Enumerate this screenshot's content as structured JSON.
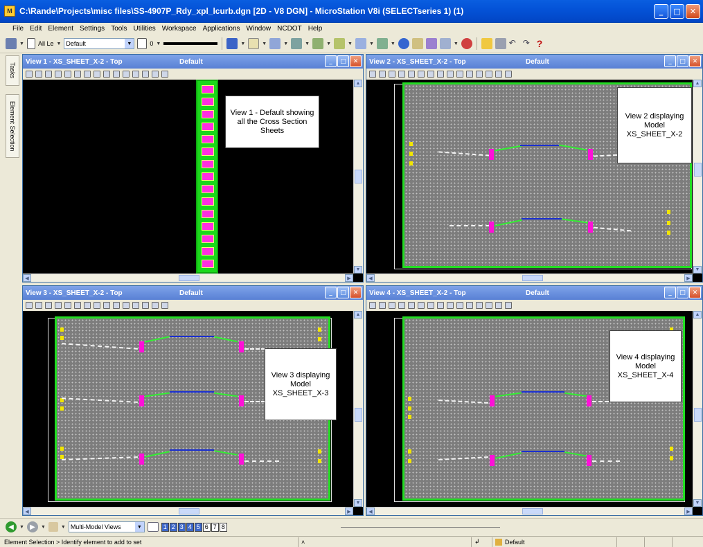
{
  "window": {
    "title": "C:\\Rande\\Projects\\misc files\\SS-4907P_Rdy_xpl_lcurb.dgn [2D - V8 DGN] - MicroStation V8i (SELECTseries 1) (1)"
  },
  "menu": [
    "File",
    "Edit",
    "Element",
    "Settings",
    "Tools",
    "Utilities",
    "Workspace",
    "Applications",
    "Window",
    "NCDOT",
    "Help"
  ],
  "toolbar": {
    "level_label": "All Le",
    "style_value": "Default",
    "weight_value": "0"
  },
  "side_tabs": [
    "Tasks",
    "Element Selection"
  ],
  "views": [
    {
      "title": "View 1 - XS_SHEET_X-2 - Top",
      "model": "Default",
      "callout": "View 1 - Default showing all the Cross Section Sheets"
    },
    {
      "title": "View 2 - XS_SHEET_X-2 - Top",
      "model": "Default",
      "callout": "View 2 displaying Model XS_SHEET_X-2"
    },
    {
      "title": "View 3 - XS_SHEET_X-2 - Top",
      "model": "Default",
      "callout": "View 3 displaying Model XS_SHEET_X-3"
    },
    {
      "title": "View 4 - XS_SHEET_X-2 - Top",
      "model": "Default",
      "callout": "View 4 displaying Model XS_SHEET_X-4"
    }
  ],
  "bottom": {
    "view_group": "Multi-Model Views",
    "view_numbers": [
      "1",
      "2",
      "3",
      "4",
      "5",
      "6",
      "7",
      "8"
    ],
    "active_views": 5
  },
  "status": {
    "prompt": "Element Selection > Identify element to add to set",
    "active_level": "Default"
  },
  "colors": {
    "titlebar": "#0453d8",
    "view_title": "#5880d5",
    "sheet_border": "#22dd22",
    "section_marker": "#ff10d8"
  }
}
